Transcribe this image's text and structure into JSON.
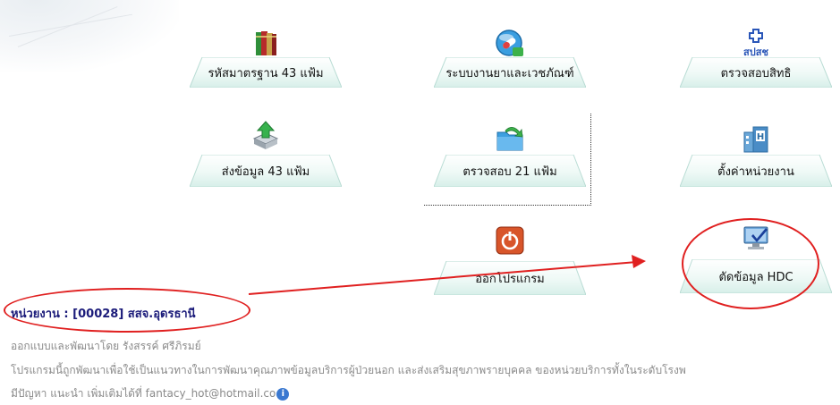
{
  "menu": [
    {
      "id": "standard-43",
      "label": "รหัสมาตรฐาน 43 แฟ้ม",
      "icon": "books-icon"
    },
    {
      "id": "drug-system",
      "label": "ระบบงานยาและเวชภัณฑ์",
      "icon": "pill-bubble-icon"
    },
    {
      "id": "check-rights",
      "label": "ตรวจสอบสิทธิ",
      "icon": "nhso-logo-icon"
    },
    {
      "id": "send-43",
      "label": "ส่งข้อมูล 43 แฟ้ม",
      "icon": "upload-arrow-icon"
    },
    {
      "id": "check-21",
      "label": "ตรวจสอบ 21 แฟ้ม",
      "icon": "folder-arrow-icon"
    },
    {
      "id": "unit-settings",
      "label": "ตั้งค่าหน่วยงาน",
      "icon": "building-icon"
    },
    {
      "id": "exit",
      "label": "ออกโปรแกรม",
      "icon": "power-icon"
    },
    {
      "id": "hdc",
      "label": "ตัดข้อมูล HDC",
      "icon": "monitor-check-icon"
    }
  ],
  "nhso_text": "สปสช",
  "unit": "หน่วยงาน : [00028] สสจ.อุดรธานี",
  "footer": {
    "designer": "ออกแบบและพัฒนาโดย รังสรรค์ ศรีภิรมย์",
    "description": "โปรแกรมนี้ถูกพัฒนาเพื่อใช้เป็นแนวทางในการพัฒนาคุณภาพข้อมูลบริการผู้ป่วยนอก และส่งเสริมสุขภาพรายบุคคล ของหน่วยบริการทั้งในระดับโรงพ",
    "contact": "มีปัญหา แนะนำ เพิ่มเติมได้ที่ fantacy_hot@hotmail.co"
  },
  "colors": {
    "annotation": "#e02020",
    "unit_text": "#1b1b7a",
    "plate_light": "#eaf7f4",
    "plate_edge": "#b9dcd4"
  }
}
